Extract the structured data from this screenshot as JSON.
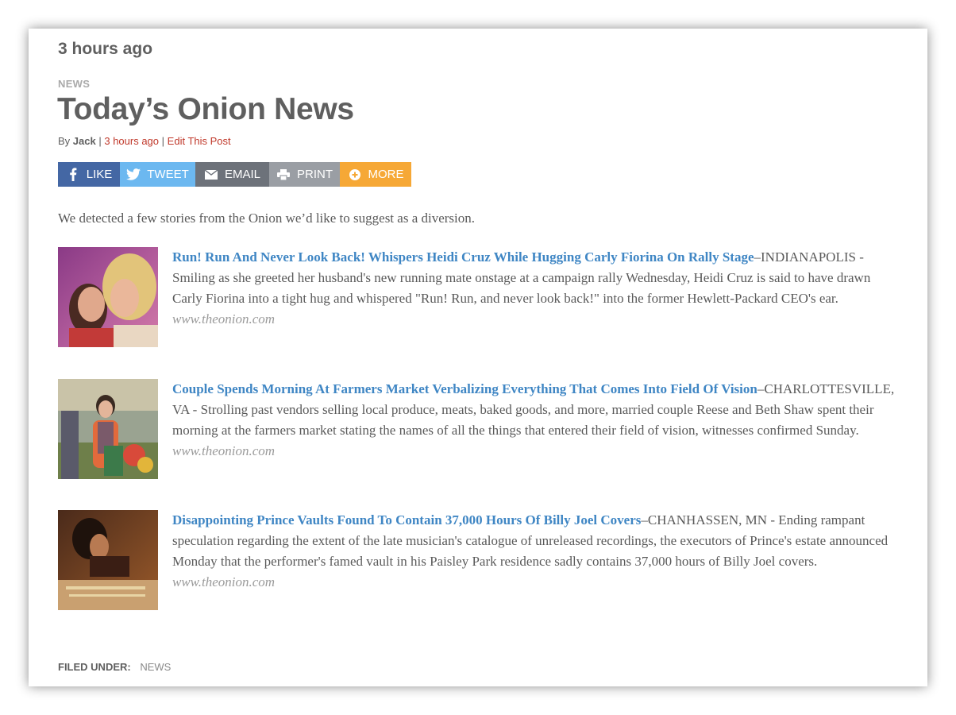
{
  "post": {
    "timestamp": "3 hours ago",
    "category": "NEWS",
    "title": "Today’s Onion News",
    "byline": {
      "by": "By",
      "author": "Jack",
      "separator1": "|",
      "time": "3 hours ago",
      "separator2": "|",
      "edit": "Edit This Post"
    },
    "intro": "We detected a few stories from the Onion we’d like to suggest as a diversion."
  },
  "share": {
    "like": "LIKE",
    "tweet": "TWEET",
    "email": "EMAIL",
    "print": "PRINT",
    "more": "MORE",
    "colors": {
      "like": "#4467a4",
      "tweet": "#6cb8f0",
      "email": "#6d727a",
      "print": "#9a9ea4",
      "more": "#f6a836"
    }
  },
  "stories": [
    {
      "headline": "Run! Run And Never Look Back! Whispers Heidi Cruz While Hugging Carly Fiorina On Rally Stage",
      "dash": "–",
      "body": "INDIANAPOLIS - Smiling as she greeted her husband's new running mate onstage at a campaign rally Wednesday, Heidi Cruz is said to have drawn Carly Fiorina into a tight hug and whispered \"Run! Run, and never look back!\" into the former Hewlett-Packard CEO's ear.",
      "source": "www.theonion.com"
    },
    {
      "headline": "Couple Spends Morning At Farmers Market Verbalizing Everything That Comes Into Field Of Vision",
      "dash": "–",
      "body": "CHARLOTTESVILLE, VA - Strolling past vendors selling local produce, meats, baked goods, and more, married couple Reese and Beth Shaw spent their morning at the farmers market stating the names of all the things that entered their field of vision, witnesses confirmed Sunday.",
      "source": "www.theonion.com"
    },
    {
      "headline": "Disappointing Prince Vaults Found To Contain 37,000 Hours Of Billy Joel Covers",
      "dash": "–",
      "body": "CHANHASSEN, MN - Ending rampant speculation regarding the extent of the late musician's catalogue of unreleased recordings, the executors of Prince's estate announced Monday that the performer's famed vault in his Paisley Park residence sadly contains 37,000 hours of Billy Joel covers.",
      "source": "www.theonion.com"
    }
  ],
  "footer": {
    "filed_label": "FILED UNDER:",
    "filed_tag": "NEWS"
  },
  "colors": {
    "link": "#3f86c4",
    "edit_link": "#c0392b",
    "text": "#5a5a5a"
  }
}
